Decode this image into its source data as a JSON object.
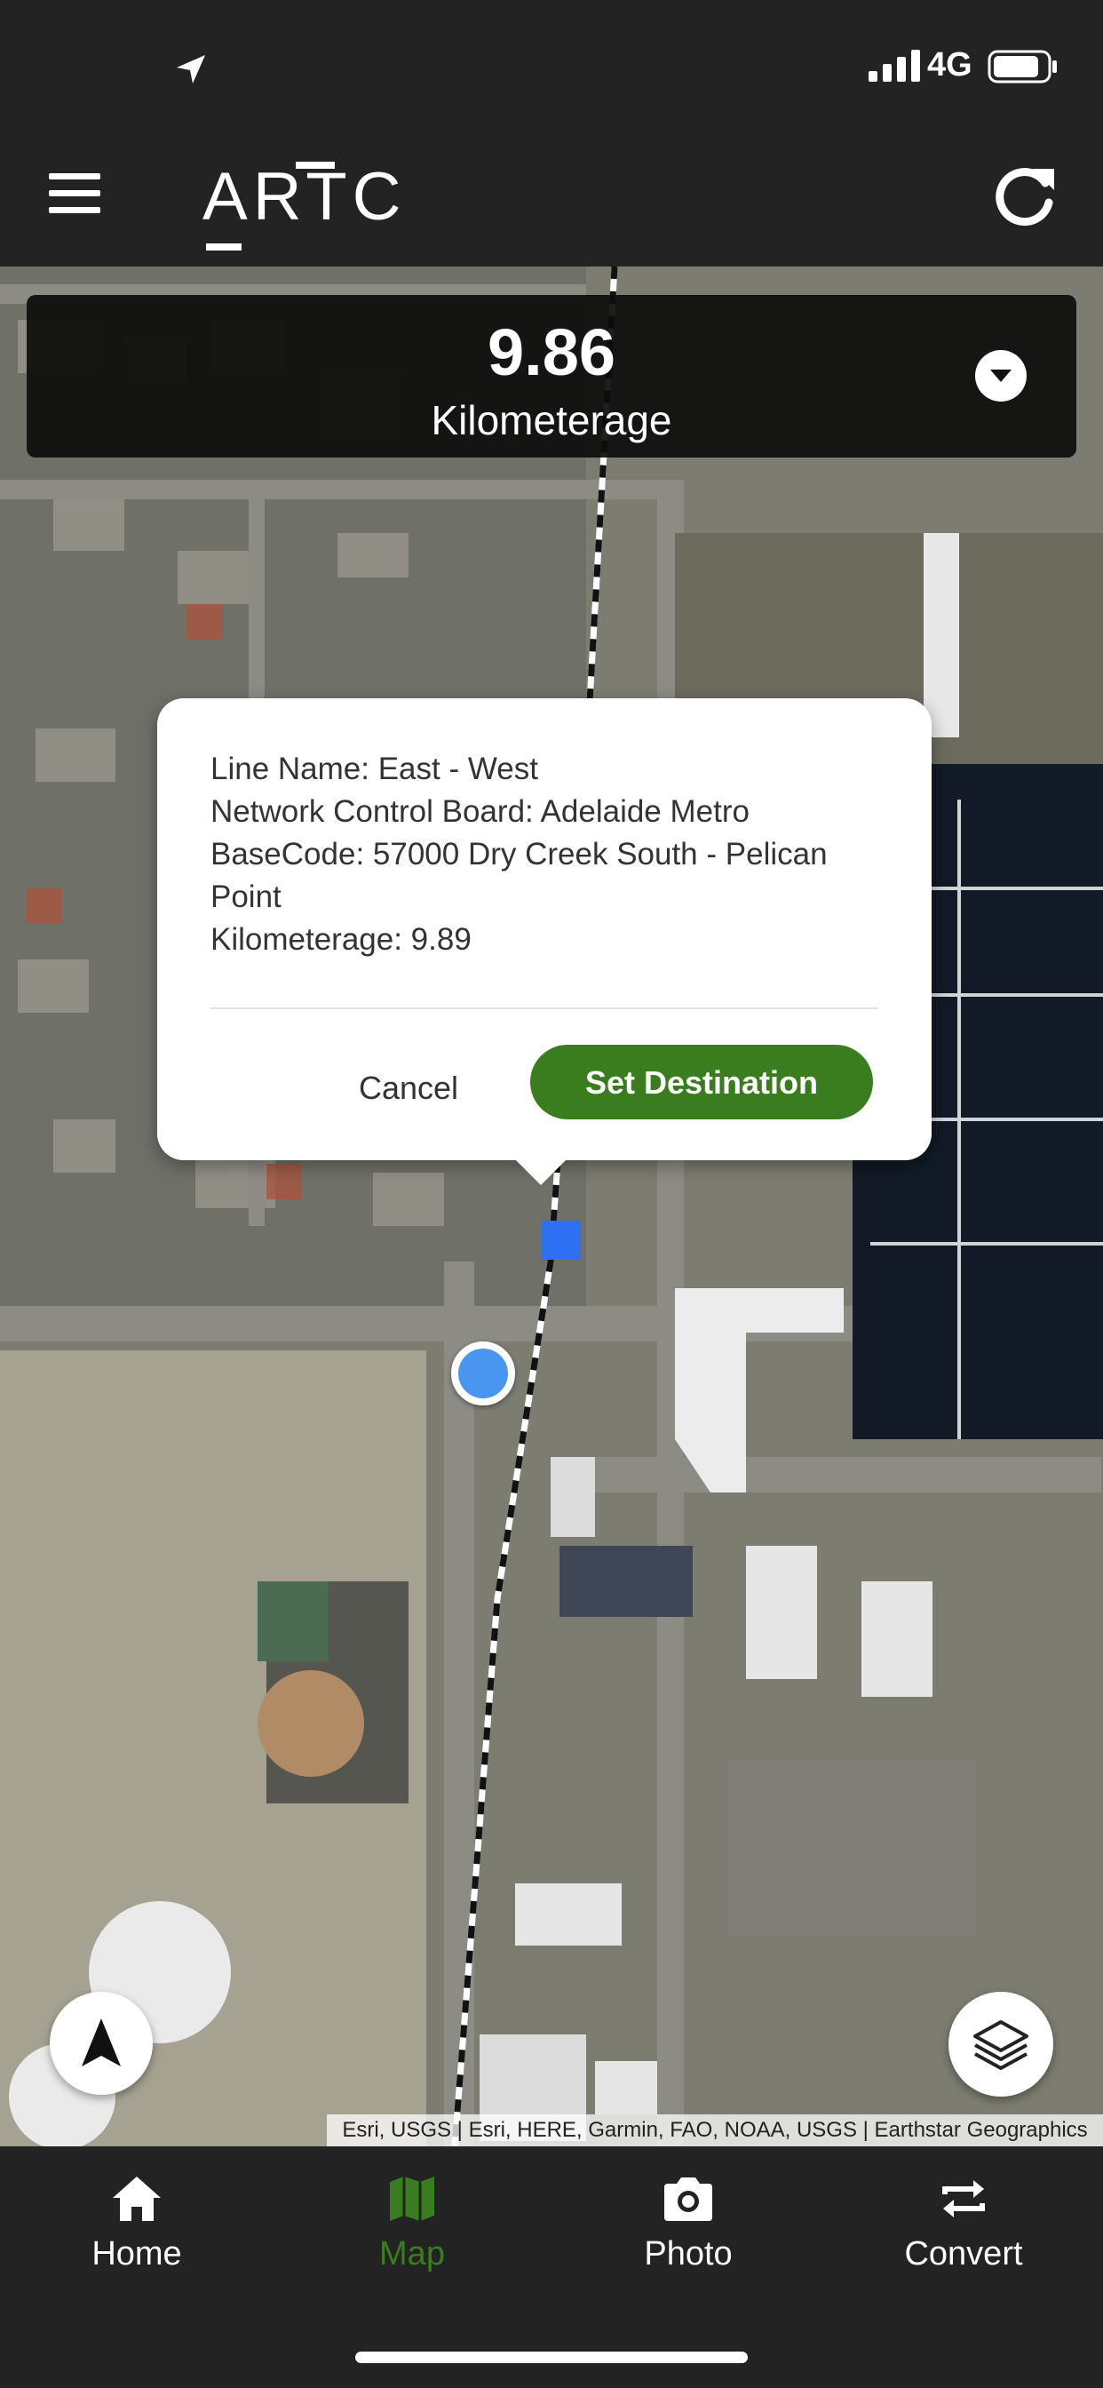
{
  "status_bar": {
    "network": "4G"
  },
  "header": {
    "logo_text": "ARTC"
  },
  "kilometerage_panel": {
    "value": "9.86",
    "label": "Kilometerage"
  },
  "popup": {
    "line_name": "Line Name: East - West",
    "network_control_board": "Network Control Board: Adelaide Metro",
    "basecode": "BaseCode: 57000 Dry Creek South - Pelican Point",
    "kilometerage": "Kilometerage: 9.89",
    "cancel_label": "Cancel",
    "set_destination_label": "Set Destination"
  },
  "map": {
    "attribution": "Esri, USGS | Esri, HERE, Garmin, FAO, NOAA, USGS | Earthstar Geographics"
  },
  "bottom_nav": {
    "items": [
      {
        "label": "Home",
        "icon": "home-icon"
      },
      {
        "label": "Map",
        "icon": "map-icon",
        "active": true
      },
      {
        "label": "Photo",
        "icon": "camera-icon"
      },
      {
        "label": "Convert",
        "icon": "convert-icon"
      }
    ]
  },
  "colors": {
    "accent": "#3a7d1e",
    "marker": "#2f6ff1",
    "location": "#4a95f0"
  }
}
